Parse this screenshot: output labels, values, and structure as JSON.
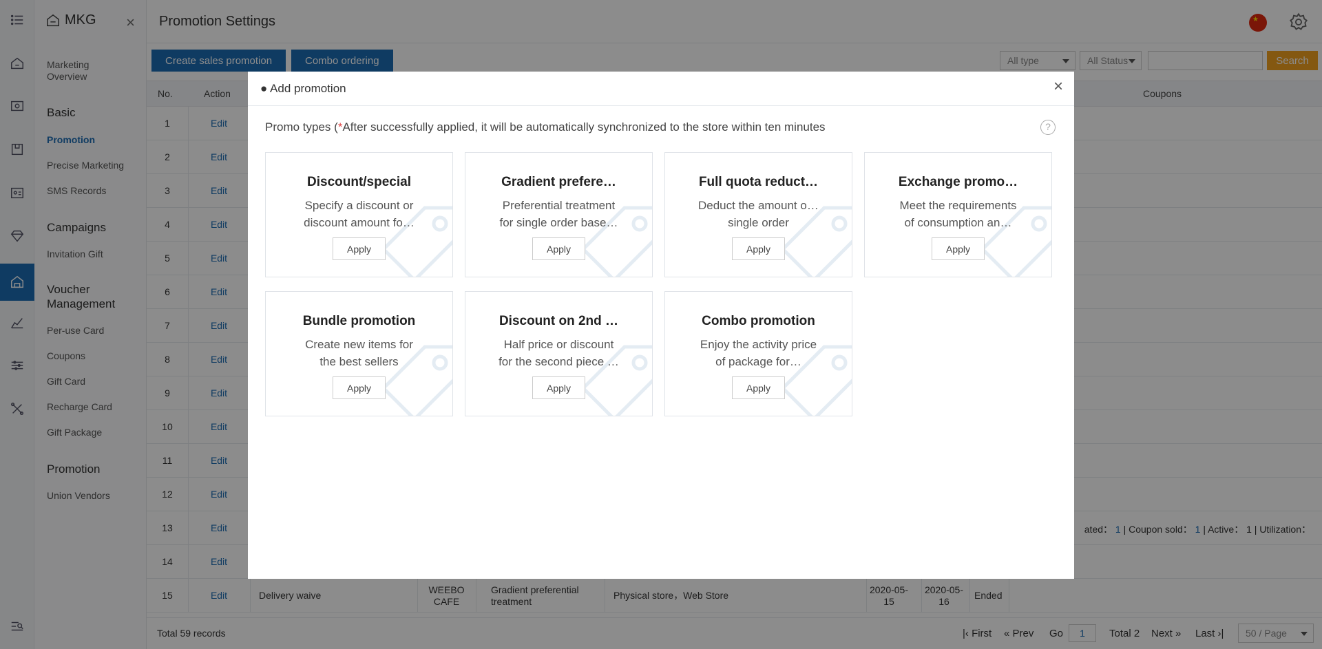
{
  "app": {
    "brand": "MKG",
    "page_title": "Promotion Settings"
  },
  "rail": {
    "icons": [
      "menu-icon",
      "home-icon",
      "cashier-icon",
      "store-icon",
      "member-card-icon",
      "diamond-icon",
      "marketing-icon",
      "analytics-icon",
      "sliders-icon",
      "tools-icon",
      "search-list-icon"
    ]
  },
  "sidebar": {
    "overview": "Marketing Overview",
    "groups": {
      "basic": "Basic",
      "campaigns": "Campaigns",
      "voucher": "Voucher Management",
      "promotion": "Promotion"
    },
    "items": {
      "promotion": "Promotion",
      "precise": "Precise Marketing",
      "sms": "SMS Records",
      "invitation": "Invitation Gift",
      "peruse": "Per-use Card",
      "coupons": "Coupons",
      "giftcard": "Gift Card",
      "recharge": "Recharge Card",
      "giftpkg": "Gift Package",
      "union": "Union Vendors"
    }
  },
  "toolbar": {
    "create_label": "Create sales promotion",
    "combo_label": "Combo ordering",
    "type_select": "All type",
    "status_select": "All Status",
    "search_label": "Search"
  },
  "table": {
    "headers": {
      "no": "No.",
      "action": "Action",
      "coupons": "Coupons"
    },
    "rows": [
      "1",
      "2",
      "3",
      "4",
      "5",
      "6",
      "7",
      "8",
      "9",
      "10",
      "11",
      "12",
      "13",
      "14",
      "15"
    ],
    "edit_label": "Edit",
    "row13_stats": {
      "prefix": "ated：",
      "created_val": "1",
      "sold_label": "| Coupon sold：",
      "sold_val": "1",
      "active_label": "| Active：",
      "active_val": "1",
      "util_label": "| Utilization："
    },
    "row15": {
      "name": "Delivery waive",
      "store": "WEEBO CAFE",
      "type": "Gradient preferential treatment",
      "channel": "Physical store，Web Store",
      "start": "2020-05-15",
      "end": "2020-05-16",
      "status": "Ended"
    }
  },
  "footer": {
    "total": "Total 59 records",
    "first": "First",
    "prev": "Prev",
    "go": "Go",
    "page": "1",
    "total_pages": "Total 2",
    "next": "Next",
    "last": "Last",
    "per_page": "50 / Page"
  },
  "modal": {
    "title": "● Add promotion",
    "hint_prefix": "Promo types (",
    "hint_star": "*",
    "hint_text": "After successfully applied, it will be automatically synchronized to the store within ten minutes",
    "help": "?",
    "apply_label": "Apply",
    "cards": [
      {
        "title": "Discount/special",
        "desc1": "Specify a discount or",
        "desc2": "discount amount fo…"
      },
      {
        "title": "Gradient prefere…",
        "desc1": "Preferential treatment",
        "desc2": "for single order base…"
      },
      {
        "title": "Full quota reduct…",
        "desc1": "Deduct the amount of a",
        "desc2": "single order"
      },
      {
        "title": "Exchange promo…",
        "desc1": "Meet the requirements",
        "desc2": "of consumption an…"
      },
      {
        "title": "Bundle promotion",
        "desc1": "Create new items for",
        "desc2": "the best sellers"
      },
      {
        "title": "Discount on 2nd …",
        "desc1": "Half price or discount",
        "desc2": "for the second piece …"
      },
      {
        "title": "Combo promotion",
        "desc1": "Enjoy the activity price",
        "desc2": "of package for…"
      }
    ]
  },
  "colors": {
    "brand": "#1c6cb3",
    "search": "#f0a020",
    "ended": "#e04040",
    "overlay": "rgba(0,0,0,0.45)"
  }
}
